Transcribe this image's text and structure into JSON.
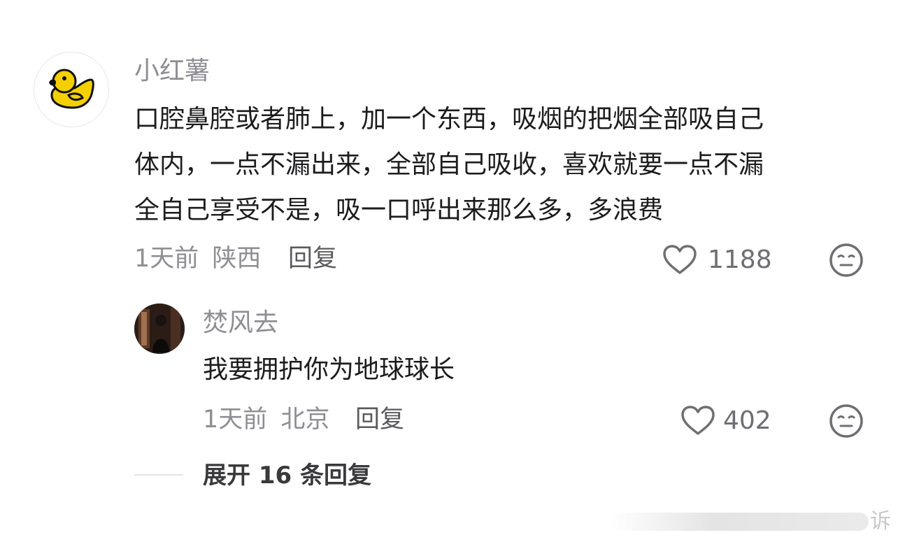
{
  "comment": {
    "username": "小红薯",
    "text_lines": [
      "口腔鼻腔或者肺上，加一个东西，吸烟的把烟全部吸自己",
      "体内，一点不漏出来，全部自己吸收，喜欢就要一点不漏",
      "全自己享受不是，吸一口呼出来那么多，多浪费"
    ],
    "time": "1天前",
    "location": "陕西",
    "reply_label": "回复",
    "like_count": "1188",
    "icons": {
      "avatar": "duck-avatar-icon",
      "like": "heart-outline-icon",
      "emoji": "neutral-face-icon"
    }
  },
  "reply": {
    "username": "焚风去",
    "text": "我要拥护你为地球球长",
    "time": "1天前",
    "location": "北京",
    "reply_label": "回复",
    "like_count": "402"
  },
  "expand": {
    "label": "展开 16 条回复"
  },
  "watermark": {
    "char": "诉"
  },
  "colors": {
    "username": "#8e8e93",
    "content": "#1c1c1e",
    "meta": "#8e8e93",
    "duck": "#f5d000"
  }
}
